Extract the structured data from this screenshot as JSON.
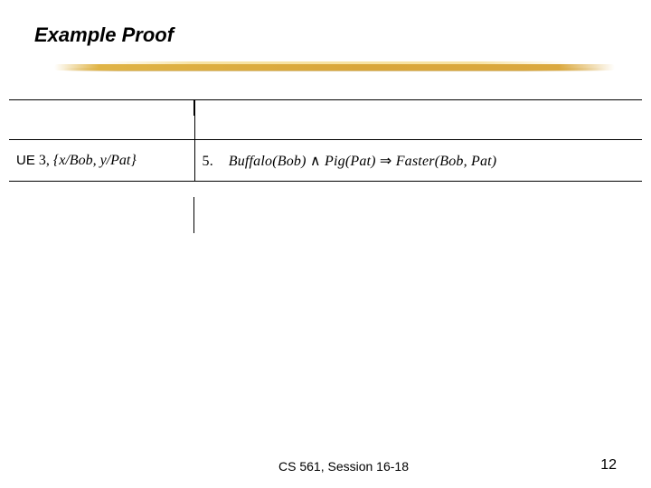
{
  "slide": {
    "title": "Example Proof"
  },
  "proof": {
    "rule_label": "UE",
    "rule_number": "3,",
    "substitution": "{x/Bob, y/Pat}",
    "stmt_number": "5.",
    "predicate_buffalo": "Buffalo",
    "arg_bob": "(Bob)",
    "conj": " ∧ ",
    "predicate_pig": "Pig",
    "arg_pat": "(Pat)",
    "implies": " ⇒ ",
    "predicate_faster": "Faster",
    "arg_bobpat": "(Bob, Pat)"
  },
  "footer": {
    "course": "CS 561,  Session 16-18",
    "page": "12"
  }
}
